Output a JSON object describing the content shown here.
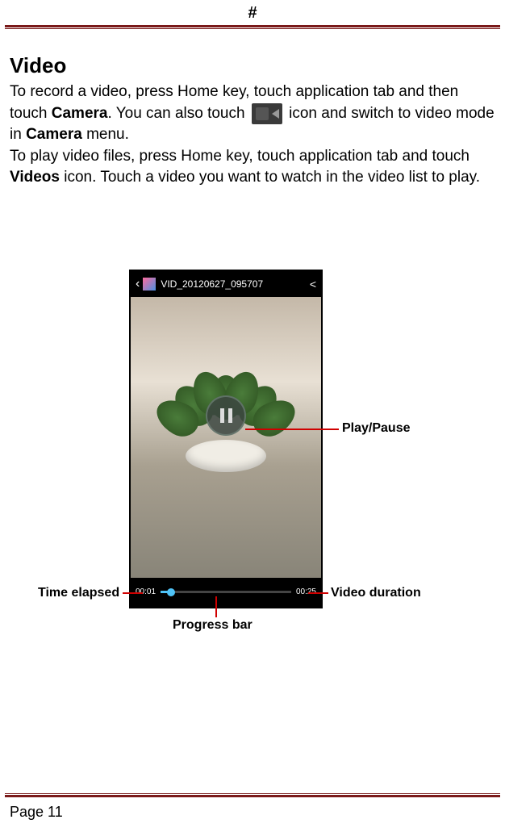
{
  "header": {
    "symbol": "#"
  },
  "section": {
    "title": "Video",
    "para1_part1": "To record a video, press Home key, touch application tab and then touch ",
    "para1_bold1": "Camera",
    "para1_part2": ". You can also touch ",
    "para1_part3": " icon and switch to video mode in ",
    "para1_bold2": "Camera",
    "para1_part4": " menu.",
    "para2_part1": "To play video files, press Home key, touch application tab and touch ",
    "para2_bold1": "Videos",
    "para2_part2": " icon. Touch a video you want to watch in the video list to play."
  },
  "screenshot": {
    "video_filename": "VID_20120627_095707",
    "time_elapsed": "00:01",
    "time_total": "00:25"
  },
  "annotations": {
    "play_pause": "Play/Pause",
    "time_elapsed": "Time elapsed",
    "video_duration": "Video duration",
    "progress_bar": "Progress bar"
  },
  "footer": {
    "page": "Page 11"
  }
}
